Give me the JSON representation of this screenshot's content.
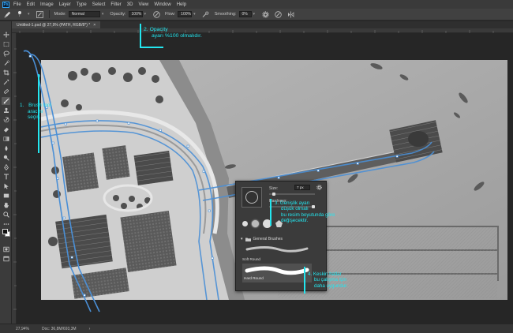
{
  "app": {
    "logo": "Ps"
  },
  "menu": [
    "File",
    "Edit",
    "Image",
    "Layer",
    "Type",
    "Select",
    "Filter",
    "3D",
    "View",
    "Window",
    "Help"
  ],
  "options_bar": {
    "brush_size": "7",
    "mode_label": "Mode:",
    "mode_value": "Normal",
    "opacity_label": "Opacity:",
    "opacity_value": "100%",
    "flow_label": "Flow:",
    "flow_value": "100%",
    "smoothing_label": "Smoothing:",
    "smoothing_value": "0%"
  },
  "document_tab": {
    "title": "Untitled-1.psd @ 27,9% (PATH, RGB/8*) *",
    "close": "×"
  },
  "status_bar": {
    "zoom": "27,94%",
    "doc_info": "Doc: 36,8M/693,3M"
  },
  "brush_panel": {
    "size_label": "Size:",
    "size_value": "7 px",
    "hardness_label": "Hardness:",
    "folder_label": "General Brushes",
    "brushes": [
      {
        "name": "Soft Round"
      },
      {
        "name": "Hard Round"
      }
    ]
  },
  "annotations": {
    "a1": {
      "num": "1.",
      "lines": [
        "Brush tool",
        "aracını",
        "seçin."
      ]
    },
    "a2": {
      "num": "2.",
      "lines": [
        "Opacity",
        "ayarı %100 olmalıdır."
      ]
    },
    "a3": {
      "num": "3.",
      "lines": [
        "Genişlik ayarı",
        "düşük olmalı",
        "bu resim boyutunda göre",
        "değişecektir."
      ]
    },
    "a4": {
      "num": "4.",
      "lines": [
        "Keskin hatlar",
        "bu çalışma için",
        "daha uygundur."
      ]
    }
  },
  "colors": {
    "accent_annotation": "#23e6ef",
    "path_stroke": "#4a8fd6",
    "ui_dark": "#282828",
    "panel_bg": "#3b3b3b"
  },
  "icons": {
    "toolbar": [
      "move-icon",
      "marquee-icon",
      "lasso-icon",
      "quick-select-icon",
      "crop-icon",
      "eyedropper-icon",
      "healing-icon",
      "brush-icon",
      "stamp-icon",
      "history-brush-icon",
      "eraser-icon",
      "gradient-icon",
      "blur-icon",
      "dodge-icon",
      "pen-icon",
      "type-icon",
      "path-select-icon",
      "rectangle-icon",
      "hand-icon",
      "zoom-icon"
    ]
  }
}
